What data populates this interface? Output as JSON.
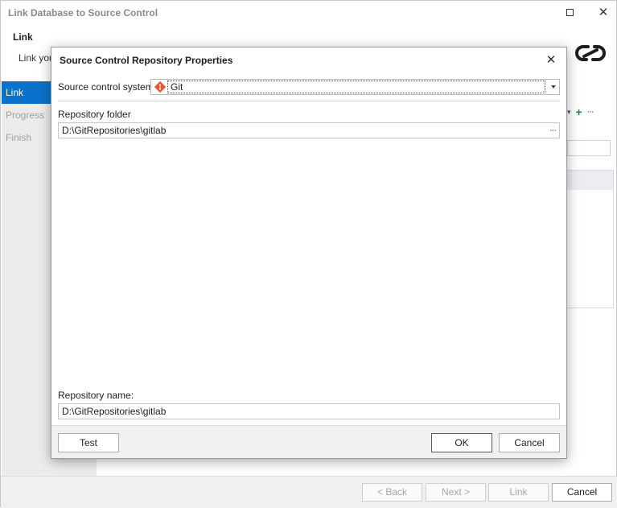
{
  "window": {
    "title": "Link Database to Source Control",
    "header_title": "Link",
    "header_subtitle": "Link your"
  },
  "sidebar": {
    "items": [
      {
        "label": "Link",
        "active": true
      },
      {
        "label": "Progress",
        "active": false
      },
      {
        "label": "Finish",
        "active": false
      }
    ]
  },
  "footer": {
    "back_label": "< Back",
    "next_label": "Next >",
    "link_label": "Link",
    "cancel_label": "Cancel"
  },
  "dialog": {
    "title": "Source Control Repository Properties",
    "source_control_label": "Source control system:",
    "source_control_value": "Git",
    "repository_folder_label": "Repository folder",
    "repository_folder_value": "D:\\GitRepositories\\gitlab",
    "repository_name_label": "Repository name:",
    "repository_name_value": "D:\\GitRepositories\\gitlab",
    "test_label": "Test",
    "ok_label": "OK",
    "cancel_label": "Cancel"
  },
  "colors": {
    "accent": "#0a73c9",
    "git_orange": "#f05133",
    "add_green": "#2a8a2a"
  },
  "icons": {
    "git": "git-logo-icon",
    "link_brand": "link-chain-icon"
  }
}
